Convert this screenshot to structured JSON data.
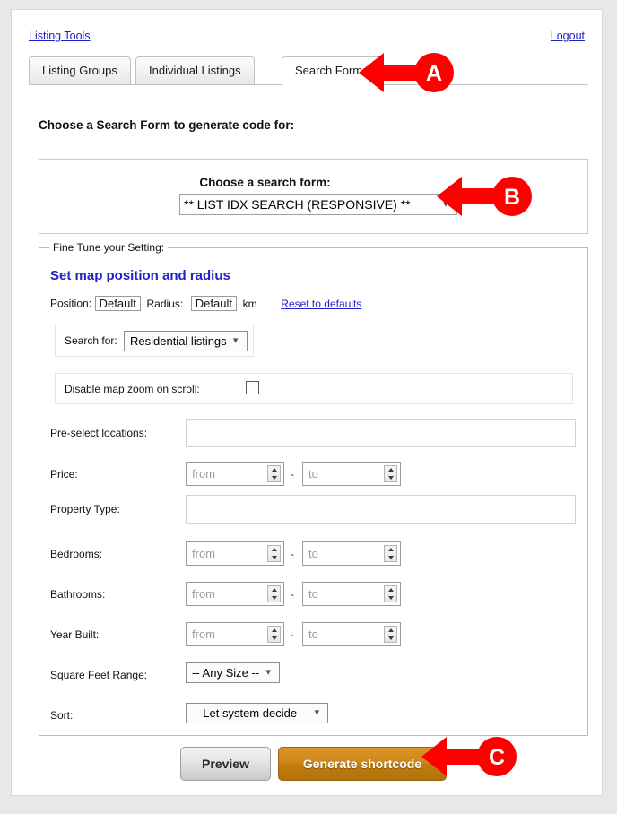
{
  "header": {
    "listing_tools_link": "Listing Tools",
    "logout_link": "Logout"
  },
  "tabs": [
    {
      "label": "Listing Groups",
      "active": false
    },
    {
      "label": "Individual Listings",
      "active": false
    },
    {
      "label": "Search Forms",
      "active": true
    }
  ],
  "section_heading": "Choose a Search Form to generate code for:",
  "choose_form": {
    "label": "Choose a search form:",
    "selected": "** LIST IDX SEARCH (RESPONSIVE) **",
    "caret_icon": "chevron-down-icon"
  },
  "fine_tune": {
    "legend": "Fine Tune your Setting:",
    "map_link": "Set map position and radius",
    "position_label": "Position:",
    "position_value": "Default",
    "radius_label": "Radius:",
    "radius_value": "Default",
    "radius_unit": "km",
    "reset_link": "Reset to defaults",
    "search_for_label": "Search for:",
    "search_for_value": "Residential listings",
    "disable_zoom_label": "Disable map zoom on scroll:",
    "disable_zoom_checked": false,
    "rows": {
      "preselect_label": "Pre-select locations:",
      "preselect_value": "",
      "price_label": "Price:",
      "property_type_label": "Property Type:",
      "property_type_value": "",
      "bedrooms_label": "Bedrooms:",
      "bathrooms_label": "Bathrooms:",
      "year_built_label": "Year Built:",
      "sqft_label": "Square Feet Range:",
      "sqft_value": "-- Any Size --",
      "sort_label": "Sort:",
      "sort_value": "-- Let system decide --"
    },
    "range_from_placeholder": "from",
    "range_to_placeholder": "to",
    "range_separator": "-"
  },
  "buttons": {
    "preview": "Preview",
    "generate": "Generate shortcode"
  },
  "callouts": [
    {
      "letter": "A",
      "target": "search-forms-tab"
    },
    {
      "letter": "B",
      "target": "choose-form-select"
    },
    {
      "letter": "C",
      "target": "generate-shortcode-button"
    }
  ],
  "colors": {
    "link": "#2222CC",
    "callout_red": "#FF0000",
    "generate_orange": "#CF8718",
    "page_background": "#FFFFFF",
    "outer_background": "#E8E8E8"
  }
}
